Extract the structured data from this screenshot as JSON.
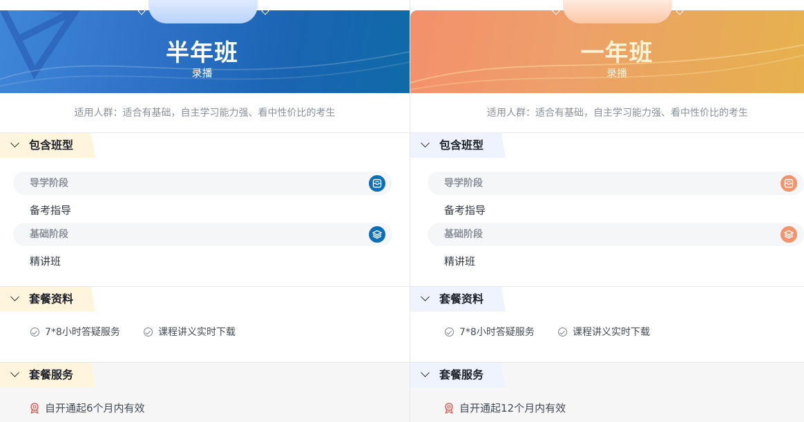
{
  "plans": [
    {
      "title": "半年班",
      "subtitle": "录播",
      "audience": "适用人群：适合有基础，自主学习能力强、看中性价比的考生",
      "sections": {
        "included": {
          "heading": "包含班型",
          "stages": [
            {
              "stage": "导学阶段",
              "icon": "book-icon",
              "item": "备考指导"
            },
            {
              "stage": "基础阶段",
              "icon": "layers-icon",
              "item": "精讲班"
            }
          ]
        },
        "materials": {
          "heading": "套餐资料",
          "features": [
            "7*8小时答疑服务",
            "课程讲义实时下载"
          ]
        },
        "services": {
          "heading": "套餐服务",
          "validity": "自开通起6个月内有效"
        }
      },
      "accent": "#0d6fb8"
    },
    {
      "title": "一年班",
      "subtitle": "录播",
      "audience": "适用人群：适合有基础，自主学习能力强、看中性价比的考生",
      "sections": {
        "included": {
          "heading": "包含班型",
          "stages": [
            {
              "stage": "导学阶段",
              "icon": "book-icon",
              "item": "备考指导"
            },
            {
              "stage": "基础阶段",
              "icon": "layers-icon",
              "item": "精讲班"
            }
          ]
        },
        "materials": {
          "heading": "套餐资料",
          "features": [
            "7*8小时答疑服务",
            "课程讲义实时下载"
          ]
        },
        "services": {
          "heading": "套餐服务",
          "validity": "自开通起12个月内有效"
        }
      },
      "accent": "#f2936c"
    }
  ]
}
